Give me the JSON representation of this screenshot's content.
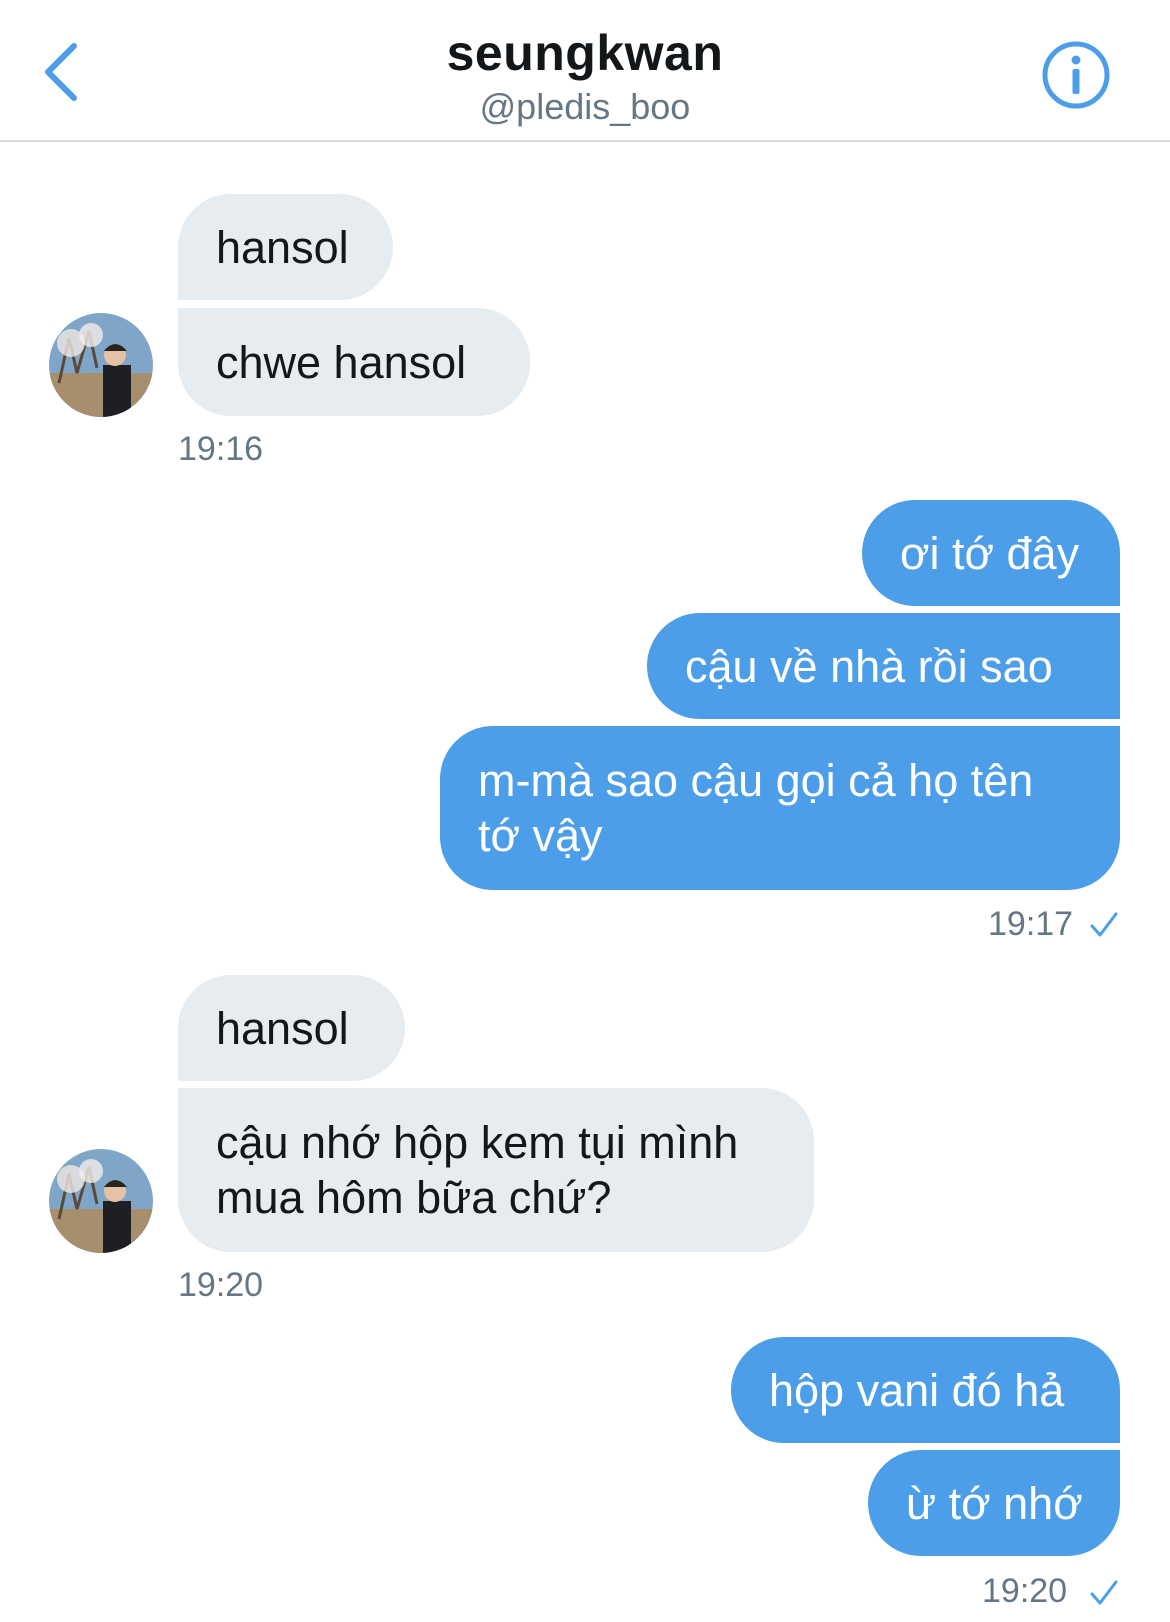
{
  "header": {
    "title": "seungkwan",
    "handle": "@pledis_boo"
  },
  "messages": [
    {
      "from": "them",
      "text": "hansol"
    },
    {
      "from": "them",
      "text": "chwe hansol"
    },
    {
      "from": "them_time",
      "text": "19:16"
    },
    {
      "from": "me",
      "text": "ơi tớ đây"
    },
    {
      "from": "me",
      "text": "cậu về nhà rồi sao"
    },
    {
      "from": "me",
      "text": "m-mà sao cậu gọi cả họ tên tớ vậy"
    },
    {
      "from": "me_time",
      "text": "19:17"
    },
    {
      "from": "them",
      "text": "hansol"
    },
    {
      "from": "them",
      "text": "cậu nhớ hộp kem tụi mình mua hôm bữa chứ?"
    },
    {
      "from": "them_time",
      "text": "19:20"
    },
    {
      "from": "me",
      "text": "hộp vani đó hả"
    },
    {
      "from": "me",
      "text": "ừ tớ nhớ"
    },
    {
      "from": "me_time",
      "text": "19:20"
    }
  ],
  "colors": {
    "accent": "#4c9ee8",
    "received_bubble": "#e6ecf0",
    "timestamp": "#657786"
  },
  "icons": {
    "back": "chevron-left-icon",
    "info": "info-circle-icon",
    "read": "checkmark-icon"
  }
}
